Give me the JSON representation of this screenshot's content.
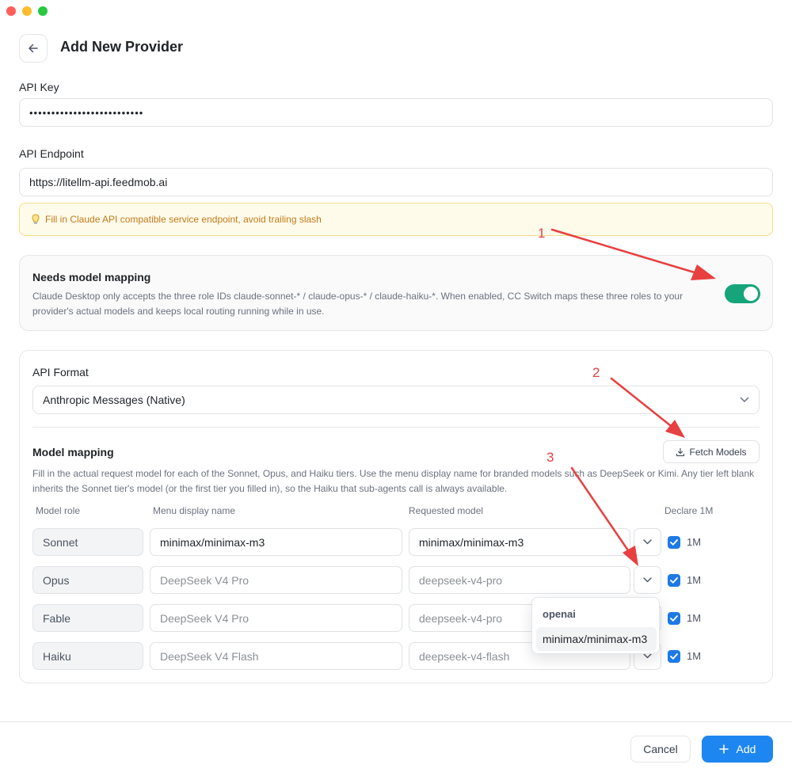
{
  "header": {
    "title": "Add New Provider"
  },
  "api_key": {
    "label": "API Key",
    "value": "••••••••••••••••••••••••••"
  },
  "api_endpoint": {
    "label": "API Endpoint",
    "value": "https://litellm-api.feedmob.ai",
    "hint": "Fill in Claude API compatible service endpoint, avoid trailing slash"
  },
  "model_mapping_toggle": {
    "title": "Needs model mapping",
    "description": "Claude Desktop only accepts the three role IDs claude-sonnet-* / claude-opus-* / claude-haiku-*. When enabled, CC Switch maps these three roles to your provider's actual models and keeps local routing running while in use.",
    "enabled": true
  },
  "api_format": {
    "label": "API Format",
    "selected": "Anthropic Messages (Native)"
  },
  "model_mapping": {
    "title": "Model mapping",
    "fetch_button": "Fetch Models",
    "description": "Fill in the actual request model for each of the Sonnet, Opus, and Haiku tiers. Use the menu display name for branded models such as DeepSeek or Kimi. Any tier left blank inherits the Sonnet tier's model (or the first tier you filled in), so the Haiku that sub-agents call is always available.",
    "columns": [
      "Model role",
      "Menu display name",
      "Requested model",
      "Declare 1M"
    ],
    "rows": [
      {
        "role": "Sonnet",
        "display_value": "minimax/minimax-m3",
        "display_placeholder": "",
        "request_value": "minimax/minimax-m3",
        "request_placeholder": "",
        "declare_1m": true,
        "declare_label": "1M"
      },
      {
        "role": "Opus",
        "display_value": "",
        "display_placeholder": "DeepSeek V4 Pro",
        "request_value": "",
        "request_placeholder": "deepseek-v4-pro",
        "declare_1m": true,
        "declare_label": "1M"
      },
      {
        "role": "Fable",
        "display_value": "",
        "display_placeholder": "DeepSeek V4 Pro",
        "request_value": "",
        "request_placeholder": "deepseek-v4-pro",
        "declare_1m": true,
        "declare_label": "1M"
      },
      {
        "role": "Haiku",
        "display_value": "",
        "display_placeholder": "DeepSeek V4 Flash",
        "request_value": "",
        "request_placeholder": "deepseek-v4-flash",
        "declare_1m": true,
        "declare_label": "1M"
      }
    ],
    "dropdown": {
      "group": "openai",
      "options": [
        "minimax/minimax-m3"
      ]
    }
  },
  "annotations": [
    "1",
    "2",
    "3"
  ],
  "footer": {
    "cancel": "Cancel",
    "add": "Add"
  },
  "colors": {
    "accent": "#1e86f0",
    "toggle_on": "#16a57a",
    "annotation": "#e84040",
    "hint_bg": "#fffbeb",
    "hint_text": "#c27a17"
  }
}
